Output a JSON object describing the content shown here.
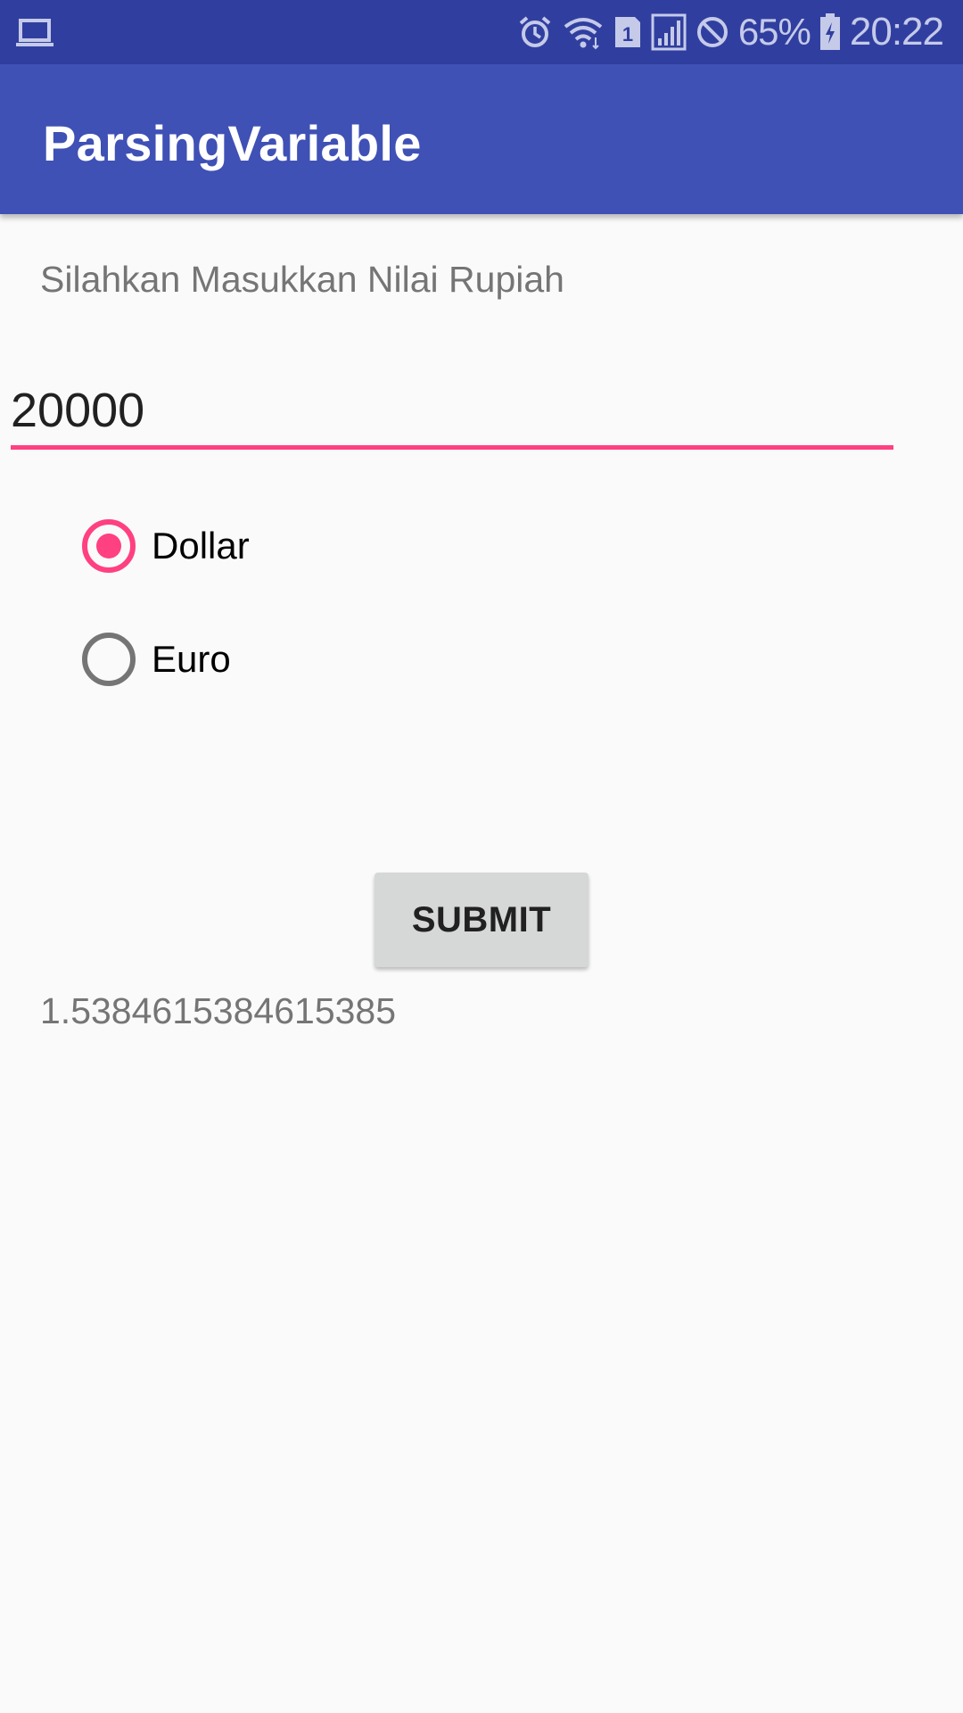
{
  "status_bar": {
    "battery_percent": "65%",
    "time": "20:22",
    "sim_slot": "1",
    "icons": [
      "laptop-icon",
      "alarm-icon",
      "wifi-icon",
      "sim-icon",
      "signal-icon",
      "do-not-disturb-icon",
      "battery-charging-icon"
    ]
  },
  "app_bar": {
    "title": "ParsingVariable"
  },
  "form": {
    "prompt": "Silahkan Masukkan Nilai Rupiah",
    "amount_value": "20000",
    "currency_options": [
      {
        "label": "Dollar",
        "selected": true
      },
      {
        "label": "Euro",
        "selected": false
      }
    ],
    "submit_label": "SUBMIT",
    "result": "1.5384615384615385"
  },
  "colors": {
    "status_bar": "#303f9f",
    "app_bar": "#3f51b5",
    "accent": "#ff4081",
    "background": "#fafafa"
  }
}
